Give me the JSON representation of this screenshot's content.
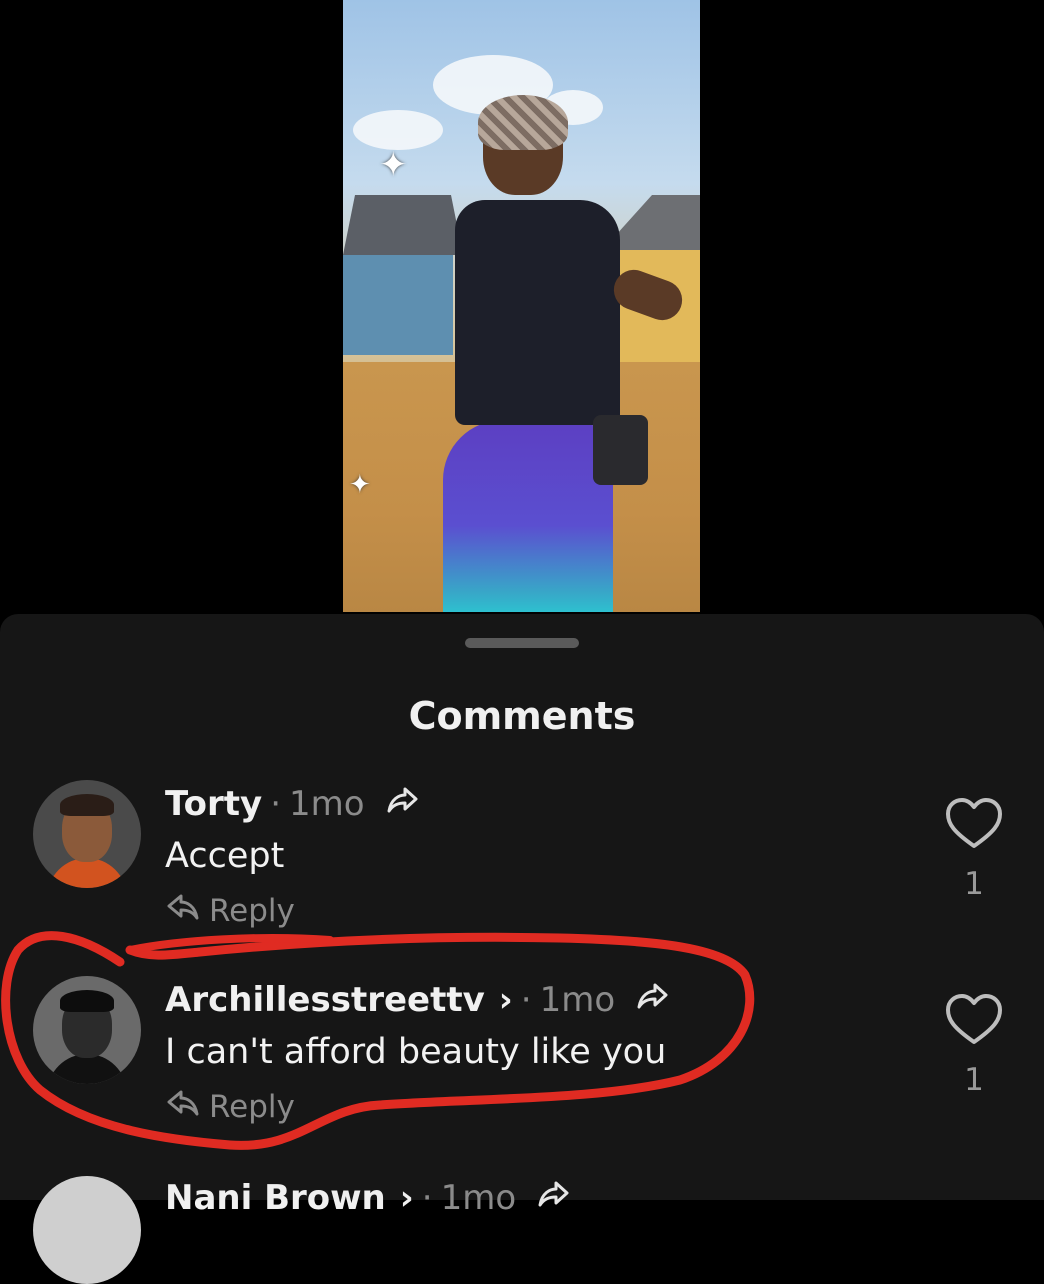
{
  "sheet": {
    "title": "Comments"
  },
  "comments": [
    {
      "user": "Torty",
      "has_chevron": false,
      "time": "1mo",
      "text": "Accept",
      "reply_label": "Reply",
      "likes": "1"
    },
    {
      "user": "Archillesstreettv",
      "has_chevron": true,
      "time": "1mo",
      "text": "I can't afford beauty like you",
      "reply_label": "Reply",
      "likes": "1"
    },
    {
      "user": "Nani Brown",
      "has_chevron": true,
      "time": "1mo",
      "text": "",
      "reply_label": "",
      "likes": ""
    }
  ],
  "icons": {
    "share": "share-arrow-icon",
    "reply": "reply-arrow-icon",
    "like": "heart-outline-icon",
    "chevron": "chevron-right-icon"
  },
  "colors": {
    "annotation": "#e02b22",
    "sheet_bg": "#161616",
    "muted_text": "#8b8b8b"
  }
}
